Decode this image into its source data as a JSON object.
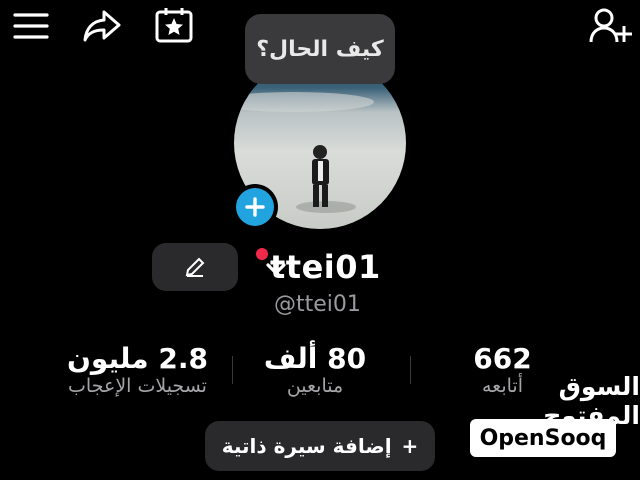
{
  "top_bar": {
    "icons": [
      "menu-icon",
      "share-icon",
      "calendar-star-icon",
      "add-user-icon"
    ]
  },
  "bubble": {
    "text": "كيف الحال؟"
  },
  "profile": {
    "username": "ttei01",
    "handle": "@ttei01"
  },
  "stats": [
    {
      "value": "2.8 مليون",
      "label": "تسجيلات الإعجاب"
    },
    {
      "value": "80 ألف",
      "label": "متابعين"
    },
    {
      "value": "662",
      "label": "أتابعه"
    }
  ],
  "bio_button": {
    "plus": "+",
    "label": "إضافة سيرة ذاتية"
  },
  "watermark": {
    "arabic": "السوق المفتوح",
    "english": "OpenSooq"
  },
  "colors": {
    "accent_blue": "#21a3e0",
    "red_dot": "#f0284a",
    "button_bg": "#2a2a2c"
  }
}
